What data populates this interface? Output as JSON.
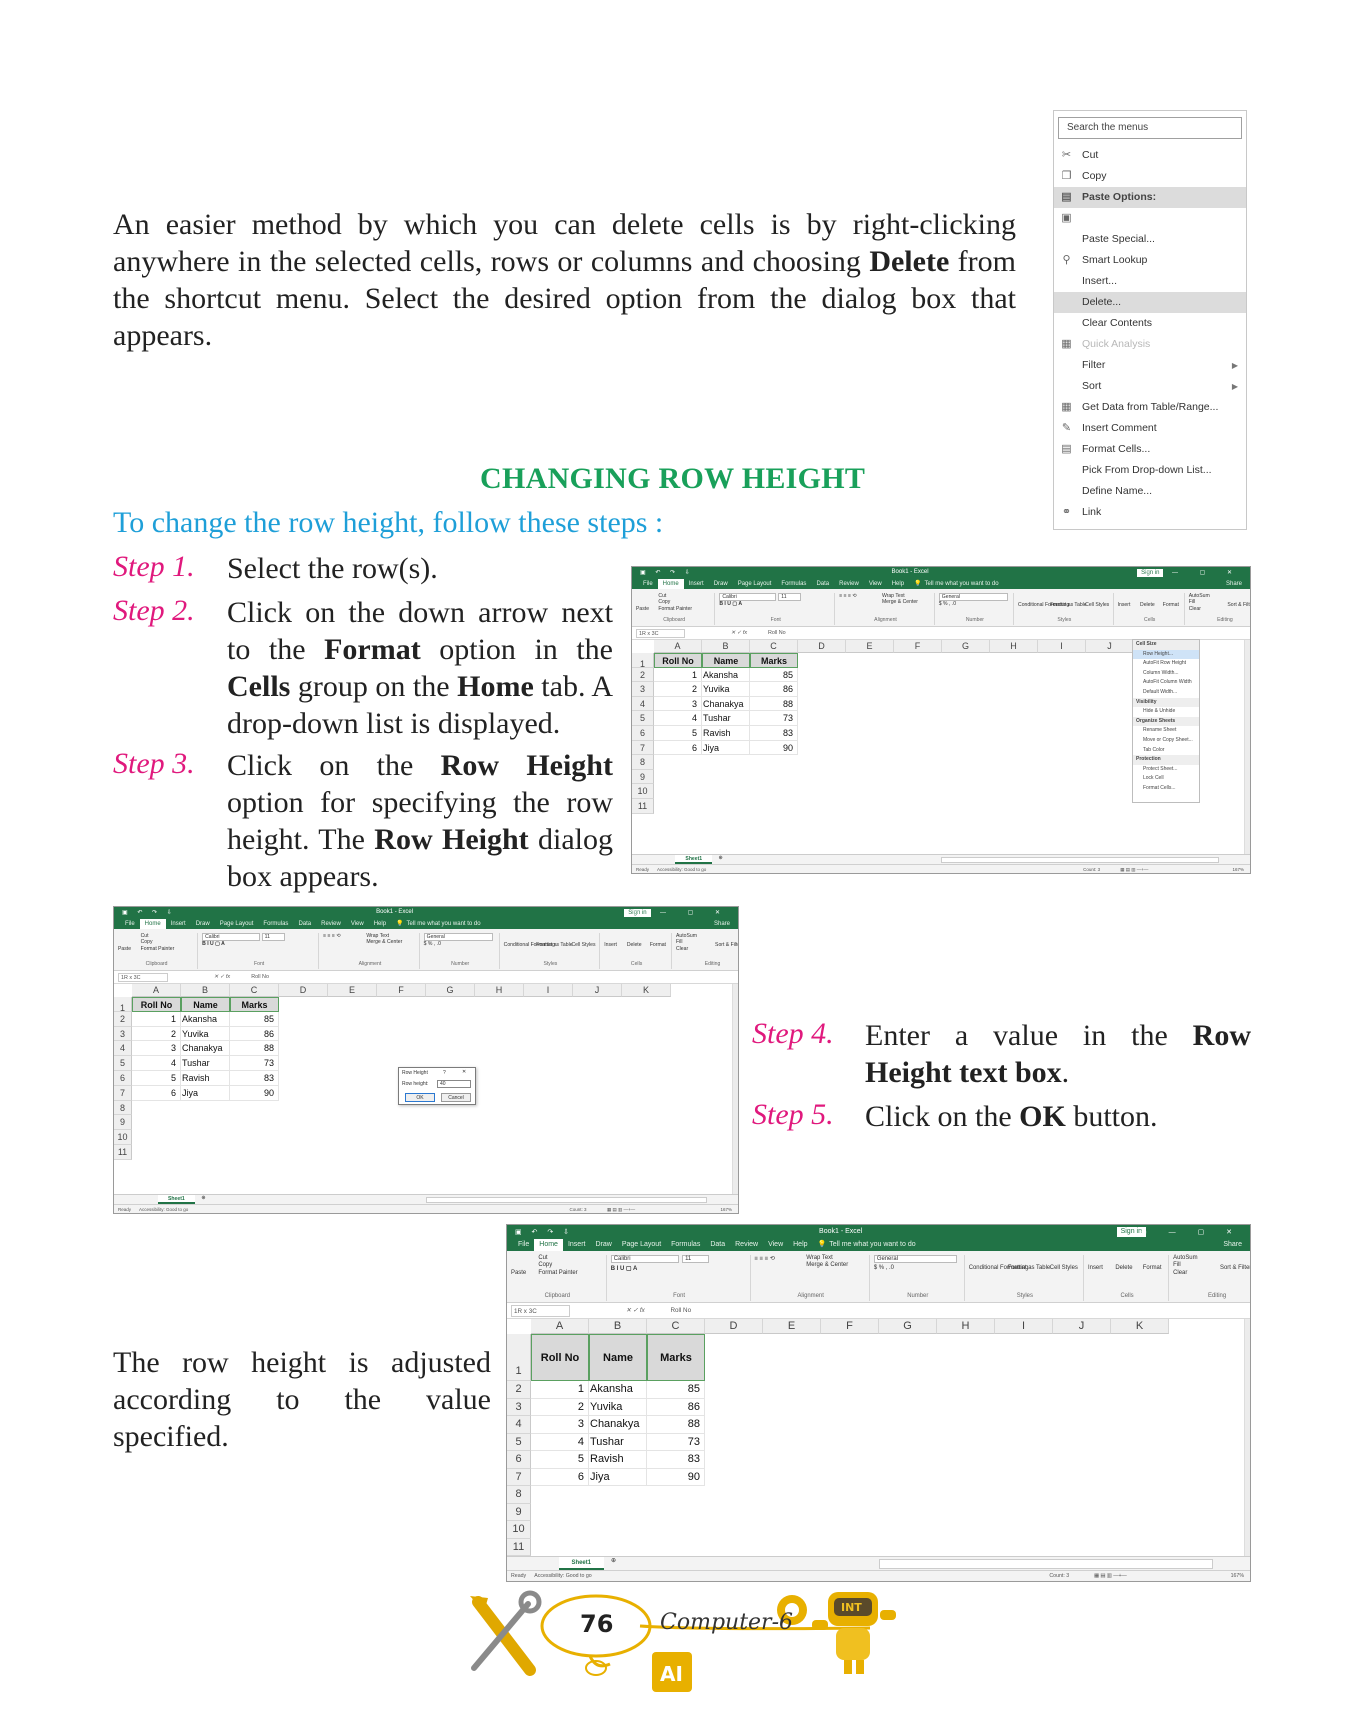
{
  "intro": {
    "p1": "An easier method by which you can delete cells is by right-clicking anywhere in the selected cells, rows or columns and choosing ",
    "p1_bold": "Delete",
    "p1_end": " from the shortcut menu. Select the desired option from the dialog box that appears."
  },
  "context_menu": {
    "search_placeholder": "Search the menus",
    "items": [
      {
        "label": "Cut",
        "icon": "scissors-icon"
      },
      {
        "label": "Copy",
        "icon": "copy-icon"
      },
      {
        "label": "Paste Options:",
        "icon": "paste-icon"
      },
      {
        "label": "",
        "icon": "paste-clipboard-icon"
      },
      {
        "label": "Paste Special...",
        "icon": ""
      },
      {
        "label": "Smart Lookup",
        "icon": "search-icon"
      },
      {
        "label": "Insert...",
        "icon": ""
      },
      {
        "label": "Delete...",
        "icon": ""
      },
      {
        "label": "Clear Contents",
        "icon": ""
      },
      {
        "label": "Quick Analysis",
        "icon": "quick-analysis-icon"
      },
      {
        "label": "Filter",
        "icon": ""
      },
      {
        "label": "Sort",
        "icon": ""
      },
      {
        "label": "Get Data from Table/Range...",
        "icon": "table-icon"
      },
      {
        "label": "Insert Comment",
        "icon": "comment-icon"
      },
      {
        "label": "Format Cells...",
        "icon": "format-cells-icon"
      },
      {
        "label": "Pick From Drop-down List...",
        "icon": ""
      },
      {
        "label": "Define Name...",
        "icon": ""
      },
      {
        "label": "Link",
        "icon": "link-icon"
      }
    ]
  },
  "section": {
    "heading": "CHANGING ROW HEIGHT",
    "subheading": "To change the row height, follow these steps :"
  },
  "steps": {
    "s1_label": "Step 1.",
    "s1_text": "Select the row(s).",
    "s2_label": "Step 2.",
    "s2_a": "Click on the down arrow next to the ",
    "s2_b1": "Format",
    "s2_c": " option in the ",
    "s2_b2": "Cells",
    "s2_d": " group on the ",
    "s2_b3": "Home",
    "s2_e": " tab. A drop-down list is displayed.",
    "s3_label": "Step 3.",
    "s3_a": "Click on the ",
    "s3_b1": "Row Height",
    "s3_c": " option for specifying the row height. The ",
    "s3_b2": "Row Height",
    "s3_d": " dialog box appears.",
    "s4_label": "Step 4.",
    "s4_a": "Enter a value in the ",
    "s4_b": "Row Height text box",
    "s4_c": ".",
    "s5_label": "Step 5.",
    "s5_a": "Click on the ",
    "s5_b": "OK",
    "s5_c": " button."
  },
  "outro": {
    "text": "The row height is adjusted according to the value specified."
  },
  "excel": {
    "title": "Book1 - Excel",
    "signin": "Sign in",
    "share": "Share",
    "tabs": [
      "File",
      "Home",
      "Insert",
      "Draw",
      "Page Layout",
      "Formulas",
      "Data",
      "Review",
      "View",
      "Help"
    ],
    "tell_me": "Tell me what you want to do",
    "name_box": "1R x 3C",
    "formula": "Roll No",
    "font": "Calibri",
    "font_size": "11",
    "number_format": "General",
    "ribbon": {
      "cut": "Cut",
      "copy": "Copy",
      "format_painter": "Format Painter",
      "paste": "Paste",
      "wrap_text": "Wrap Text",
      "merge_center": "Merge & Center",
      "conditional": "Conditional Formatting",
      "format_table": "Format as Table",
      "cell_styles": "Cell Styles",
      "insert": "Insert",
      "delete": "Delete",
      "format": "Format",
      "autosum": "AutoSum",
      "fill": "Fill",
      "clear": "Clear",
      "sort_filter": "Sort & Filter",
      "find_select": "Find & Select",
      "groups": [
        "Clipboard",
        "Font",
        "Alignment",
        "Number",
        "Styles",
        "Cells",
        "Editing"
      ]
    },
    "columns": [
      "A",
      "B",
      "C",
      "D",
      "E",
      "F",
      "G",
      "H",
      "I",
      "J",
      "K"
    ],
    "headers": [
      "Roll No",
      "Name",
      "Marks"
    ],
    "rows": [
      {
        "roll": "1",
        "name": "Akansha",
        "marks": "85"
      },
      {
        "roll": "2",
        "name": "Yuvika",
        "marks": "86"
      },
      {
        "roll": "3",
        "name": "Chanakya",
        "marks": "88"
      },
      {
        "roll": "4",
        "name": "Tushar",
        "marks": "73"
      },
      {
        "roll": "5",
        "name": "Ravish",
        "marks": "83"
      },
      {
        "roll": "6",
        "name": "Jiya",
        "marks": "90"
      }
    ],
    "row_numbers": [
      "1",
      "2",
      "3",
      "4",
      "5",
      "6",
      "7",
      "8",
      "9",
      "10",
      "11"
    ],
    "sheet": "Sheet1",
    "status_ready": "Ready",
    "status_accessibility": "Accessibility: Good to go",
    "status_count": "Count: 3",
    "zoom": "167%",
    "format_menu": {
      "sections": [
        "Cell Size",
        "Visibility",
        "Organize Sheets",
        "Protection"
      ],
      "items": [
        "Row Height...",
        "AutoFit Row Height",
        "Column Width...",
        "AutoFit Column Width",
        "Default Width...",
        "Hide & Unhide",
        "Rename Sheet",
        "Move or Copy Sheet...",
        "Tab Color",
        "Protect Sheet...",
        "Lock Cell",
        "Format Cells..."
      ]
    },
    "dialog": {
      "title": "Row Height",
      "help": "?",
      "label": "Row height:",
      "value": "40",
      "ok": "OK",
      "cancel": "Cancel"
    }
  },
  "footer": {
    "page_number": "76",
    "book": "Computer-6",
    "badge": "AI",
    "mascot_label": "INT"
  },
  "colors": {
    "heading": "#19a05a",
    "subheading": "#1e9fd8",
    "step_label": "#e0197d",
    "excel_green": "#217346",
    "footer_gold": "#e8b000"
  }
}
